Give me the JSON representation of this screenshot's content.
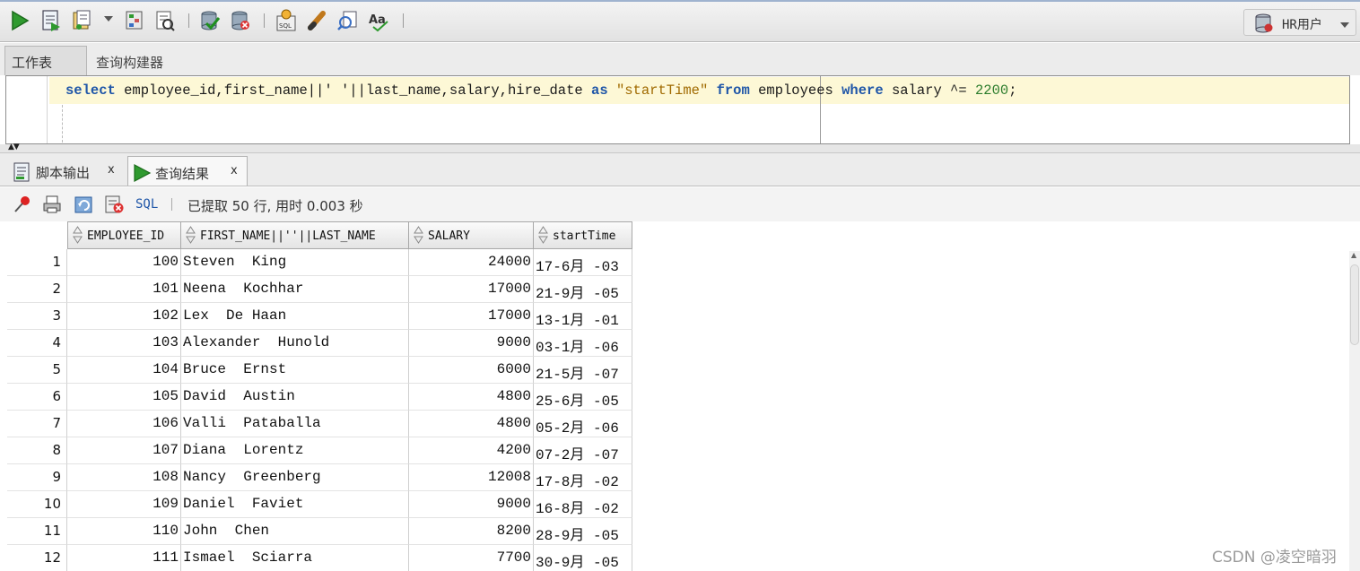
{
  "toolbar": {
    "icons": [
      "run-statement-icon",
      "run-script-icon",
      "autotrace-icon",
      "dropdown-arrow-icon",
      "explain-plan-icon",
      "sql-tuning-icon",
      "commit-icon",
      "rollback-icon",
      "sql-history-icon",
      "clear-icon",
      "find-icon",
      "format-icon"
    ],
    "user_label": "HR用户"
  },
  "worksheet_tabs": {
    "worksheet": "工作表",
    "query_builder": "查询构建器"
  },
  "editor": {
    "sql": [
      {
        "t": "select",
        "k": "kw"
      },
      {
        "t": " employee_id,first_name||' ",
        "k": ""
      },
      {
        "t": "'||last_name,salary,hire_date ",
        "k": ""
      },
      {
        "t": "as",
        "k": "kw"
      },
      {
        "t": " ",
        "k": ""
      },
      {
        "t": "\"startTime\"",
        "k": "str"
      },
      {
        "t": " ",
        "k": ""
      },
      {
        "t": "from",
        "k": "kw"
      },
      {
        "t": " employees ",
        "k": ""
      },
      {
        "t": "where",
        "k": "kw"
      },
      {
        "t": " salary ^= ",
        "k": ""
      },
      {
        "t": "2200",
        "k": "num"
      },
      {
        "t": ";",
        "k": ""
      }
    ]
  },
  "result_tabs": {
    "script_output": "脚本输出",
    "query_result": "查询结果",
    "close_glyph": "x"
  },
  "result_toolbar": {
    "sql_link": "SQL",
    "fetch_status": "已提取 50 行, 用时 0.003 秒"
  },
  "grid": {
    "columns": [
      "EMPLOYEE_ID",
      "FIRST_NAME||''||LAST_NAME",
      "SALARY",
      "startTime"
    ],
    "rows": [
      {
        "rn": "1",
        "id": "100",
        "name": "Steven  King",
        "salary": "24000",
        "date": "17-6月 -03"
      },
      {
        "rn": "2",
        "id": "101",
        "name": "Neena  Kochhar",
        "salary": "17000",
        "date": "21-9月 -05"
      },
      {
        "rn": "3",
        "id": "102",
        "name": "Lex  De Haan",
        "salary": "17000",
        "date": "13-1月 -01"
      },
      {
        "rn": "4",
        "id": "103",
        "name": "Alexander  Hunold",
        "salary": "9000",
        "date": "03-1月 -06"
      },
      {
        "rn": "5",
        "id": "104",
        "name": "Bruce  Ernst",
        "salary": "6000",
        "date": "21-5月 -07"
      },
      {
        "rn": "6",
        "id": "105",
        "name": "David  Austin",
        "salary": "4800",
        "date": "25-6月 -05"
      },
      {
        "rn": "7",
        "id": "106",
        "name": "Valli  Pataballa",
        "salary": "4800",
        "date": "05-2月 -06"
      },
      {
        "rn": "8",
        "id": "107",
        "name": "Diana  Lorentz",
        "salary": "4200",
        "date": "07-2月 -07"
      },
      {
        "rn": "9",
        "id": "108",
        "name": "Nancy  Greenberg",
        "salary": "12008",
        "date": "17-8月 -02"
      },
      {
        "rn": "10",
        "id": "109",
        "name": "Daniel  Faviet",
        "salary": "9000",
        "date": "16-8月 -02"
      },
      {
        "rn": "11",
        "id": "110",
        "name": "John  Chen",
        "salary": "8200",
        "date": "28-9月 -05"
      },
      {
        "rn": "12",
        "id": "111",
        "name": "Ismael  Sciarra",
        "salary": "7700",
        "date": "30-9月 -05"
      }
    ]
  },
  "watermark": "CSDN @凌空暗羽"
}
